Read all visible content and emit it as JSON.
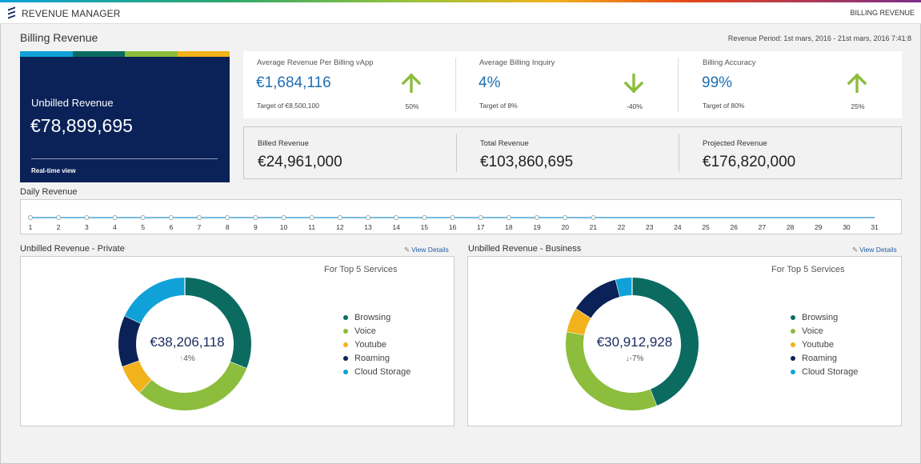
{
  "app": {
    "title": "REVENUE MANAGER",
    "breadcrumb": "BILLING REVENUE"
  },
  "page": {
    "title": "Billing Revenue",
    "period": "Revenue Period: 1st mars, 2016 - 21st mars, 2016 7:41:8"
  },
  "unbilled": {
    "label": "Unbilled Revenue",
    "value": "€78,899,695",
    "footer": "Real-time view",
    "stripe_colors": [
      "#0fa1d8",
      "#0b6b61",
      "#8cbd3c",
      "#f2b21b"
    ]
  },
  "kpis": [
    {
      "label": "Average Revenue Per Billing vApp",
      "value": "€1,684,116",
      "target": "Target of €8,500,100",
      "change": "50%",
      "direction": "up"
    },
    {
      "label": "Average Billing Inquiry",
      "value": "4%",
      "target": "Target of 8%",
      "change": "-40%",
      "direction": "down"
    },
    {
      "label": "Billing Accuracy",
      "value": "99%",
      "target": "Target of 80%",
      "change": "25%",
      "direction": "up"
    }
  ],
  "revenues": [
    {
      "label": "Billed Revenue",
      "value": "€24,961,000"
    },
    {
      "label": "Total Revenue",
      "value": "€103,860,695"
    },
    {
      "label": "Projected Revenue",
      "value": "€176,820,000"
    }
  ],
  "daily": {
    "title": "Daily Revenue",
    "days": [
      "1",
      "2",
      "3",
      "4",
      "5",
      "6",
      "7",
      "8",
      "9",
      "10",
      "11",
      "12",
      "13",
      "14",
      "15",
      "16",
      "17",
      "18",
      "19",
      "20",
      "21",
      "22",
      "23",
      "24",
      "25",
      "26",
      "27",
      "28",
      "29",
      "30",
      "31"
    ],
    "points_through_day": 21,
    "line_color": "#4fa3db"
  },
  "colors": {
    "up_arrow": "#8cbd3c",
    "down_arrow_kpi": "#8cbd3c",
    "down_arrow_business": "#d9312b",
    "accent_blue": "#1f6fb5",
    "navy": "#0a2257"
  },
  "donuts": [
    {
      "title": "Unbilled Revenue - Private",
      "view_details": "View Details",
      "subtitle": "For Top 5 Services",
      "value": "€38,206,118",
      "change": "4%",
      "direction": "up",
      "segments": [
        {
          "name": "Browsing",
          "share": 0.31,
          "color": "#0b6b61"
        },
        {
          "name": "Voice",
          "share": 0.31,
          "color": "#8cbd3c"
        },
        {
          "name": "Youtube",
          "share": 0.075,
          "color": "#f2b21b"
        },
        {
          "name": "Roaming",
          "share": 0.125,
          "color": "#0a2257"
        },
        {
          "name": "Cloud Storage",
          "share": 0.18,
          "color": "#0fa1d8"
        }
      ]
    },
    {
      "title": "Unbilled Revenue - Business",
      "view_details": "View Details",
      "subtitle": "For Top 5 Services",
      "value": "€30,912,928",
      "change": "-7%",
      "direction": "down",
      "segments": [
        {
          "name": "Browsing",
          "share": 0.44,
          "color": "#0b6b61"
        },
        {
          "name": "Voice",
          "share": 0.34,
          "color": "#8cbd3c"
        },
        {
          "name": "Youtube",
          "share": 0.06,
          "color": "#f2b21b"
        },
        {
          "name": "Roaming",
          "share": 0.12,
          "color": "#0a2257"
        },
        {
          "name": "Cloud Storage",
          "share": 0.04,
          "color": "#0fa1d8"
        }
      ]
    }
  ]
}
